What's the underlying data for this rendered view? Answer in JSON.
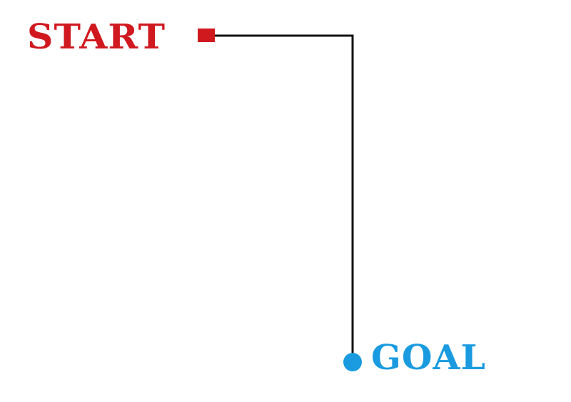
{
  "diagram": {
    "start": {
      "label": "START",
      "color": "#d0191f"
    },
    "goal": {
      "label": "GOAL",
      "color": "#1a9be0"
    },
    "path_color": "#111111"
  }
}
